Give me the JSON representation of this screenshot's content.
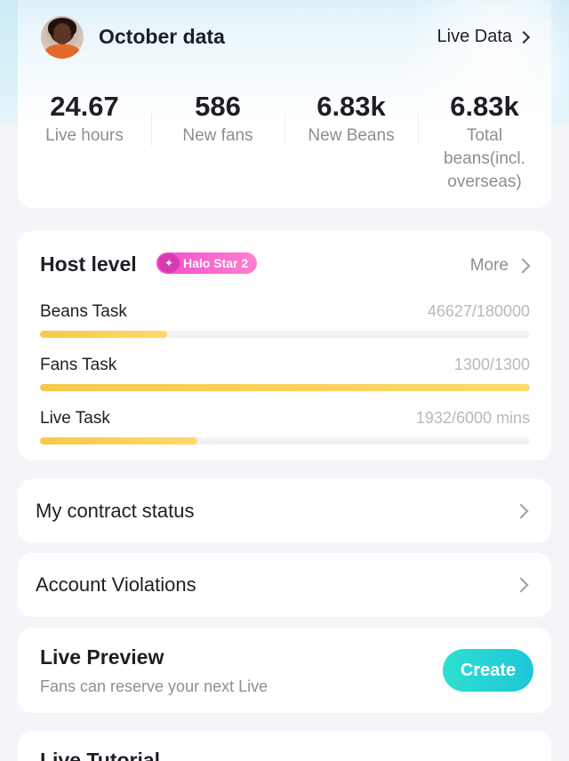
{
  "header": {
    "title": "October data",
    "live_data_link": "Live Data"
  },
  "stats": [
    {
      "value": "24.67",
      "label": "Live hours"
    },
    {
      "value": "586",
      "label": "New fans"
    },
    {
      "value": "6.83k",
      "label": "New Beans"
    },
    {
      "value": "6.83k",
      "label": "Total beans(incl. overseas)"
    }
  ],
  "host_level": {
    "title": "Host level",
    "badge": "Halo Star 2",
    "more_link": "More",
    "tasks": [
      {
        "name": "Beans Task",
        "value": "46627/180000",
        "progress": 0.259
      },
      {
        "name": "Fans Task",
        "value": "1300/1300",
        "progress": 1.0
      },
      {
        "name": "Live Task",
        "value": "1932/6000 mins",
        "progress": 0.322
      }
    ]
  },
  "contract": {
    "label": "My contract status"
  },
  "violations": {
    "label": "Account Violations"
  },
  "live_preview": {
    "title": "Live Preview",
    "subtitle": "Fans can reserve your next Live",
    "create_label": "Create"
  },
  "tutorial": {
    "title": "Live Tutorial"
  },
  "colors": {
    "progress": "#f6c94c",
    "create_button": "#1ec6d8",
    "badge": "#f04fc8"
  }
}
